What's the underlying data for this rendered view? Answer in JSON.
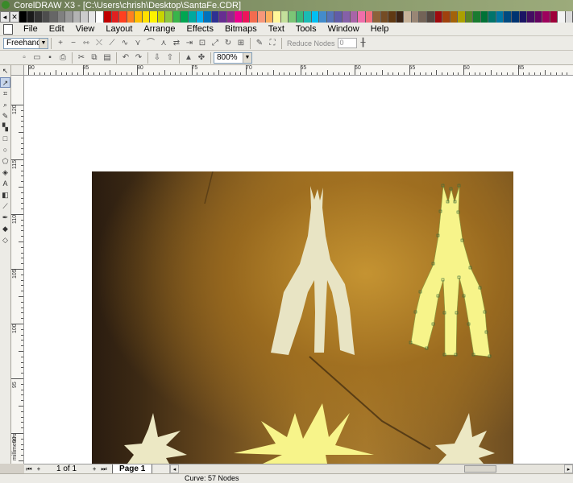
{
  "window": {
    "title": "CorelDRAW X3 - [C:\\Users\\chrish\\Desktop\\SantaFe.CDR]"
  },
  "palette": {
    "colors": [
      "#000000",
      "#1a1a1a",
      "#333333",
      "#4d4d4d",
      "#666666",
      "#808080",
      "#999999",
      "#b3b3b3",
      "#cccccc",
      "#e6e6e6",
      "#ffffff",
      "#c00000",
      "#e02020",
      "#ff4020",
      "#ff8020",
      "#ffc000",
      "#ffe000",
      "#fff200",
      "#c8d400",
      "#8cc63f",
      "#39b54a",
      "#00a651",
      "#00a99d",
      "#00aeef",
      "#0072bc",
      "#2e3192",
      "#662d91",
      "#92278f",
      "#ec008c",
      "#ed145b",
      "#f26c4f",
      "#f7977a",
      "#fbaf5d",
      "#fff799",
      "#c4df9b",
      "#7cc576",
      "#3bb878",
      "#1abbb4",
      "#00bff3",
      "#448ccb",
      "#5674b9",
      "#605ca8",
      "#8560a8",
      "#a864a8",
      "#f06eaa",
      "#f26d7d",
      "#8c6239",
      "#754c24",
      "#603913",
      "#3c2415",
      "#c7b299",
      "#998675",
      "#736357",
      "#534741",
      "#9e0b0f",
      "#a0410d",
      "#a3620a",
      "#aba000",
      "#598527",
      "#197b30",
      "#007236",
      "#00746b",
      "#0076a3",
      "#004a80",
      "#003471",
      "#1b1464",
      "#440e62",
      "#630460",
      "#9e005d",
      "#9e0039",
      "#f2f2f2",
      "#d9d9d9"
    ]
  },
  "menu": {
    "items": [
      {
        "label": "File"
      },
      {
        "label": "Edit"
      },
      {
        "label": "View"
      },
      {
        "label": "Layout"
      },
      {
        "label": "Arrange"
      },
      {
        "label": "Effects"
      },
      {
        "label": "Bitmaps"
      },
      {
        "label": "Text"
      },
      {
        "label": "Tools"
      },
      {
        "label": "Window"
      },
      {
        "label": "Help"
      }
    ]
  },
  "propbar": {
    "curve_style": "Freehand",
    "reduce_nodes_label": "Reduce Nodes",
    "reduce_value": "0"
  },
  "stdbar": {
    "zoom": "800%"
  },
  "rulers": {
    "horizontal_labels": [
      "90",
      "85",
      "80",
      "75",
      "70",
      "65",
      "60",
      "55",
      "50",
      "45"
    ],
    "vertical_labels": [
      "120",
      "115",
      "110",
      "105",
      "100",
      "95",
      "90"
    ],
    "unit": "millimeters"
  },
  "pagebar": {
    "page_count": "1 of 1",
    "tab_label": "Page 1"
  },
  "status": {
    "text": "Curve: 57 Nodes"
  }
}
